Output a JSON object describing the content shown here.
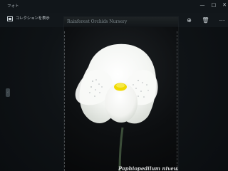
{
  "window": {
    "app_title": "フォト",
    "controls": {
      "minimize": "—",
      "maximize": "□",
      "close": "✕"
    }
  },
  "toolbar": {
    "collection_label": "コレクションを表示",
    "icons": [
      "rotate-icon",
      "slideshow-icon",
      "edit-icon",
      "zoom-icon",
      "delete-icon",
      "more-icon"
    ]
  },
  "viewer": {
    "header": "Rainforest Orchids Nursery",
    "caption": "Paphiopedilum niveum",
    "image_subject": "white orchid",
    "flower_color": "#f4f6f2",
    "lip_accent_color": "#e5d500"
  }
}
